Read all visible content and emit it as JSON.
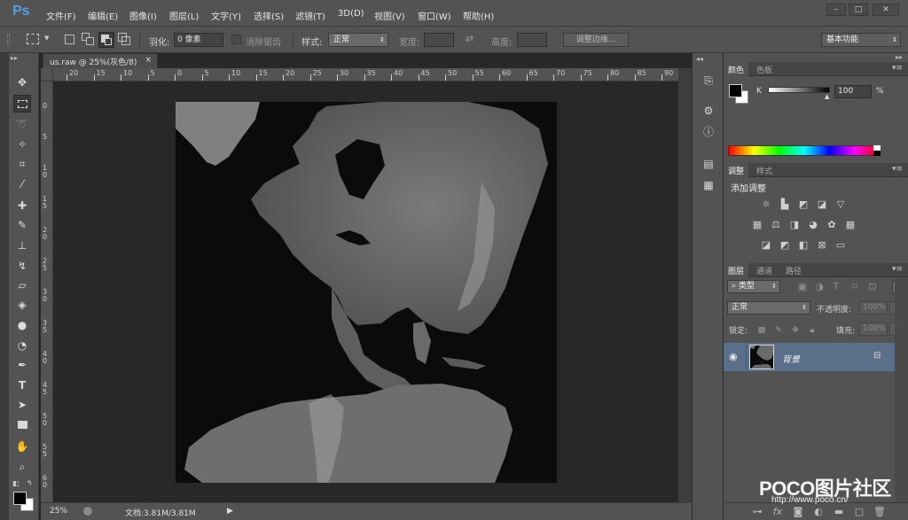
{
  "app": {
    "logo": "Ps",
    "menu": [
      "文件(F)",
      "编辑(E)",
      "图像(I)",
      "图层(L)",
      "文字(Y)",
      "选择(S)",
      "滤镜(T)",
      "3D(D)",
      "视图(V)",
      "窗口(W)",
      "帮助(H)"
    ],
    "window_buttons": [
      "‒",
      "□",
      "✕"
    ]
  },
  "options": {
    "feather_label": "羽化:",
    "feather_value": "0 像素",
    "antialias_label": "消除锯齿",
    "style_label": "样式:",
    "style_value": "正常",
    "width_label": "宽度:",
    "height_label": "高度:",
    "refine_edge_label": "调整边缘...",
    "workspace_value": "基本功能"
  },
  "document": {
    "tab_title": "us.raw @ 25%(灰色/8)",
    "tab_close": "×",
    "hruler_ticks": [
      "20",
      "15",
      "10",
      "5",
      "0",
      "5",
      "10",
      "15",
      "20",
      "25",
      "30",
      "35",
      "40",
      "45",
      "50",
      "55",
      "60",
      "65",
      "70",
      "75",
      "80",
      "85",
      "90"
    ],
    "vruler_ticks": [
      "0",
      "5",
      "1 0",
      "1 5",
      "2 0",
      "2 5",
      "3 0",
      "3 5",
      "4 0",
      "4 5",
      "5 0",
      "5 5",
      "6 0",
      "6 5"
    ],
    "zoom": "25%",
    "doc_size": "文档:3.81M/3.81M"
  },
  "panels": {
    "color_tabs": [
      "颜色",
      "色板"
    ],
    "color_channel_label": "K",
    "color_value": "100",
    "color_unit": "%",
    "adjust_tabs": [
      "调整",
      "样式"
    ],
    "adjust_title": "添加调整",
    "layers_tabs": [
      "图层",
      "通道",
      "路径"
    ],
    "layer_filter": "类型",
    "blend_mode": "正常",
    "opacity_label": "不透明度:",
    "opacity_value": "100%",
    "lock_label": "锁定:",
    "fill_label": "填充:",
    "fill_value": "100%",
    "layer_name": "背景"
  },
  "watermark": {
    "logo": "POCO图片社区",
    "url": "http://www.poco.cn/"
  },
  "colors": {
    "foreground": "#000000",
    "background": "#ffffff",
    "ui_gray": "#535353",
    "selected_layer": "#5a6f8a",
    "ps_blue": "#4fa0e6"
  },
  "icons": {
    "tools": [
      "move-icon",
      "marquee-icon",
      "lasso-icon",
      "quick-select-icon",
      "crop-icon",
      "eyedropper-icon",
      "healing-brush-icon",
      "brush-icon",
      "clone-stamp-icon",
      "history-brush-icon",
      "eraser-icon",
      "paint-bucket-icon",
      "blur-icon",
      "dodge-icon",
      "pen-icon",
      "type-icon",
      "path-select-icon",
      "rectangle-icon",
      "hand-icon",
      "zoom-icon"
    ]
  }
}
